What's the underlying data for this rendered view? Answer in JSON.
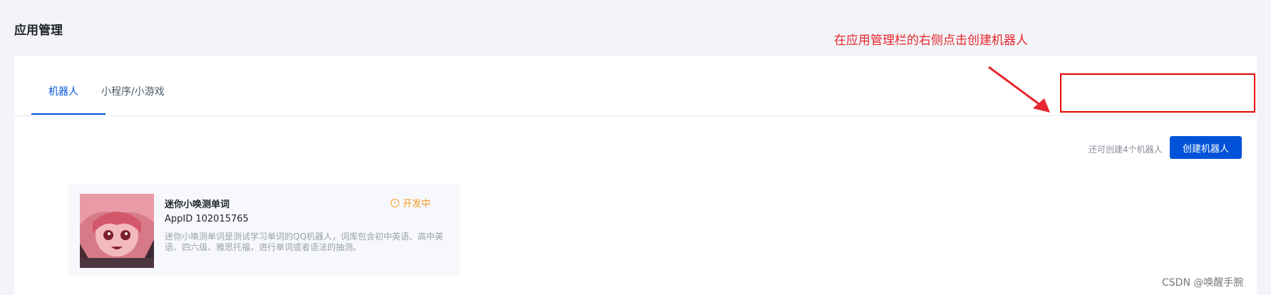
{
  "page": {
    "title": "应用管理"
  },
  "tabs": [
    {
      "label": "机器人",
      "active": true
    },
    {
      "label": "小程序/小游戏",
      "active": false
    }
  ],
  "toolbar": {
    "quota_text": "还可创建4个机器人",
    "create_button_label": "创建机器人"
  },
  "bot_card": {
    "name": "迷你小唤测单词",
    "status": "开发中",
    "status_icon": "info-circle-icon",
    "appid": "AppID 102015765",
    "description": "迷你小唤测单词是测试学习单词的QQ机器人，词库包含初中英语、高中英语、四六级、雅思托福，进行单词或者语法的抽测。"
  },
  "annotation": {
    "text": "在应用管理栏的右侧点击创建机器人",
    "color": "#e6262e"
  },
  "watermark": "CSDN @唤醒手腕",
  "colors": {
    "accent": "#0052d9",
    "status": "#f59a23",
    "highlight": "#e60000"
  }
}
